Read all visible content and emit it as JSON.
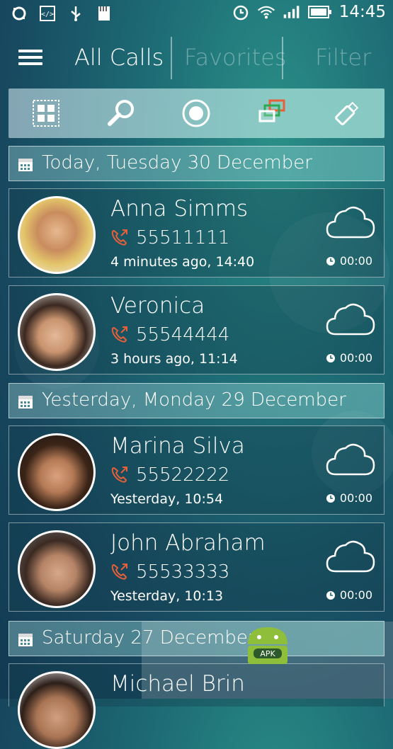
{
  "status_bar": {
    "left_icons": [
      "sync-icon",
      "code-icon",
      "usb-icon",
      "sd-card-icon"
    ],
    "right_icons": [
      "alarm-icon",
      "wifi-icon",
      "signal-icon",
      "battery-icon"
    ],
    "time": "14:45"
  },
  "header": {
    "menu_icon": "hamburger-icon",
    "tabs": [
      {
        "label": "All Calls",
        "active": true
      },
      {
        "label": "Favorites",
        "active": false
      },
      {
        "label": "Filter",
        "active": false
      }
    ]
  },
  "toolbar": {
    "buttons": [
      "grid-icon",
      "search-icon",
      "record-icon",
      "windows-icon",
      "usb-stick-icon"
    ]
  },
  "sections": [
    {
      "label": "Today, Tuesday 30 December",
      "calls": [
        {
          "name": "Anna Simms",
          "number": "55511111",
          "time": "4 minutes ago, 14:40",
          "duration": "00:00"
        },
        {
          "name": "Veronica",
          "number": "55544444",
          "time": "3 hours ago, 11:14",
          "duration": "00:00"
        }
      ]
    },
    {
      "label": "Yesterday, Monday 29 December",
      "calls": [
        {
          "name": "Marina Silva",
          "number": "55522222",
          "time": "Yesterday, 10:54",
          "duration": "00:00"
        },
        {
          "name": "John Abraham",
          "number": "55533333",
          "time": "Yesterday, 10:13",
          "duration": "00:00"
        }
      ]
    },
    {
      "label": "Saturday 27 December",
      "calls": [
        {
          "name": "Michael Brin",
          "number": "",
          "time": "",
          "duration": ""
        }
      ]
    }
  ],
  "colors": {
    "accent_orange": "#e8603a",
    "background": "#1d6a74"
  },
  "watermark": {
    "text": "APK"
  }
}
